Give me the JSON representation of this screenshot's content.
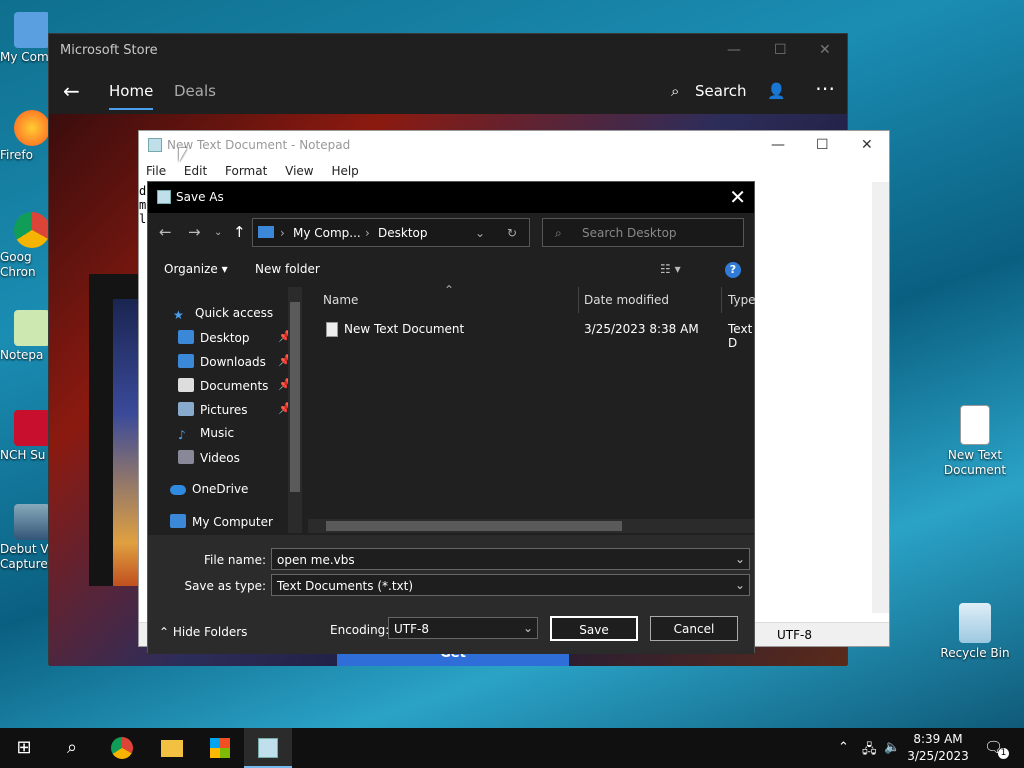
{
  "desktop": {
    "left_icons": [
      {
        "label": "My Com",
        "icon": "computer-icon"
      },
      {
        "label": "Firefo",
        "icon": "firefox-icon"
      },
      {
        "label": "Goog\nChron",
        "icon": "chrome-icon"
      },
      {
        "label": "Notepa",
        "icon": "notepad-icon"
      },
      {
        "label": "NCH Su",
        "icon": "nch-icon"
      },
      {
        "label": "Debut V\nCapture",
        "icon": "debut-icon"
      }
    ],
    "right_icons": [
      {
        "label": "New Text\nDocument",
        "icon": "text-file-icon"
      },
      {
        "label": "Recycle Bin",
        "icon": "recycle-bin-icon"
      }
    ]
  },
  "store": {
    "title": "Microsoft Store",
    "tabs": [
      "Home",
      "Deals"
    ],
    "search_label": "Search",
    "get_label": "Get"
  },
  "notepad": {
    "title": "New Text Document - Notepad",
    "menu": [
      "File",
      "Edit",
      "Format",
      "View",
      "Help"
    ],
    "text_lines": [
      "d",
      "m",
      "l"
    ],
    "encoding_status": "UTF-8"
  },
  "save_as": {
    "title": "Save As",
    "address": [
      "My Comp...",
      "Desktop"
    ],
    "search_placeholder": "Search Desktop",
    "organize_label": "Organize",
    "new_folder_label": "New folder",
    "nav_tree": [
      {
        "label": "Quick access",
        "icon": "star-icon",
        "pinned": false
      },
      {
        "label": "Desktop",
        "icon": "desktop-folder-icon",
        "pinned": true
      },
      {
        "label": "Downloads",
        "icon": "downloads-icon",
        "pinned": true
      },
      {
        "label": "Documents",
        "icon": "documents-icon",
        "pinned": true
      },
      {
        "label": "Pictures",
        "icon": "pictures-icon",
        "pinned": true
      },
      {
        "label": "Music",
        "icon": "music-icon",
        "pinned": false
      },
      {
        "label": "Videos",
        "icon": "videos-icon",
        "pinned": false
      },
      {
        "label": "OneDrive",
        "icon": "onedrive-icon",
        "pinned": false
      },
      {
        "label": "My Computer",
        "icon": "computer-icon",
        "pinned": false
      }
    ],
    "columns": [
      "Name",
      "Date modified",
      "Type"
    ],
    "files": [
      {
        "name": "New Text Document",
        "date_modified": "3/25/2023 8:38 AM",
        "type": "Text D"
      }
    ],
    "file_name_label": "File name:",
    "file_name_value": "open me.vbs",
    "save_type_label": "Save as type:",
    "save_type_value": "Text Documents (*.txt)",
    "hide_folders_label": "Hide Folders",
    "encoding_label": "Encoding:",
    "encoding_value": "UTF-8",
    "save_label": "Save",
    "cancel_label": "Cancel"
  },
  "taskbar": {
    "items": [
      "start-icon",
      "search-icon",
      "chrome-icon",
      "file-explorer-icon",
      "store-icon",
      "notepad-icon"
    ],
    "time": "8:39 AM",
    "date": "3/25/2023",
    "notification_count": "1"
  },
  "colors": {
    "accent": "#2f7bd6",
    "dialog_bg": "#202020",
    "taskbar_bg": "#101010"
  }
}
